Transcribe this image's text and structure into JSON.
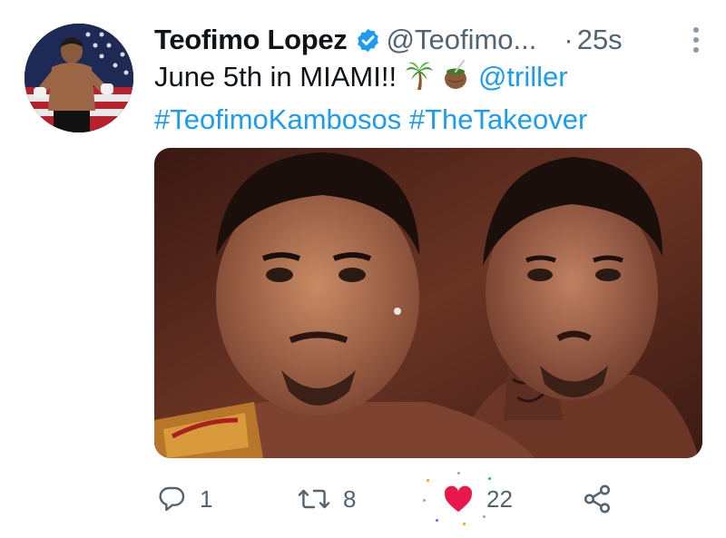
{
  "tweet": {
    "display_name": "Teofimo Lopez",
    "handle": "@Teofimo...",
    "separator": "·",
    "time": "25s",
    "text_line1": "June 5th in MIAMI!!",
    "mention": "@triller",
    "hashtag1": "#TeofimoKambosos",
    "hashtag2": "#TheTakeover",
    "emojis": [
      "palm-tree",
      "mate-drink"
    ]
  },
  "actions": {
    "reply_count": "1",
    "retweet_count": "8",
    "like_count": "22",
    "liked": true
  },
  "colors": {
    "accent": "#1d9bf0",
    "like": "#e8174c",
    "muted": "#536471",
    "verified": "#1d9bf0"
  }
}
